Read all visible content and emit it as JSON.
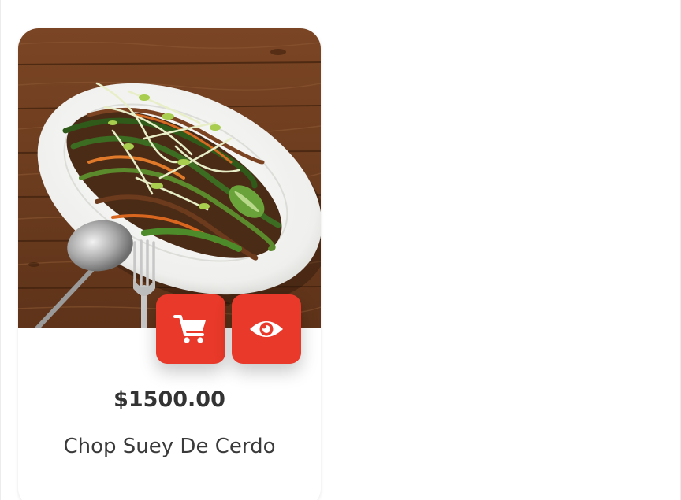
{
  "product": {
    "image_alt": "Chop Suey De Cerdo",
    "price": "$1500.00",
    "name": "Chop Suey De Cerdo"
  },
  "actions": {
    "cart_icon": "shopping-cart-icon",
    "view_icon": "eye-icon"
  },
  "colors": {
    "accent": "#e8392a",
    "price_text": "#333333",
    "name_text": "#3a3a3a",
    "card_background": "#ffffff"
  }
}
